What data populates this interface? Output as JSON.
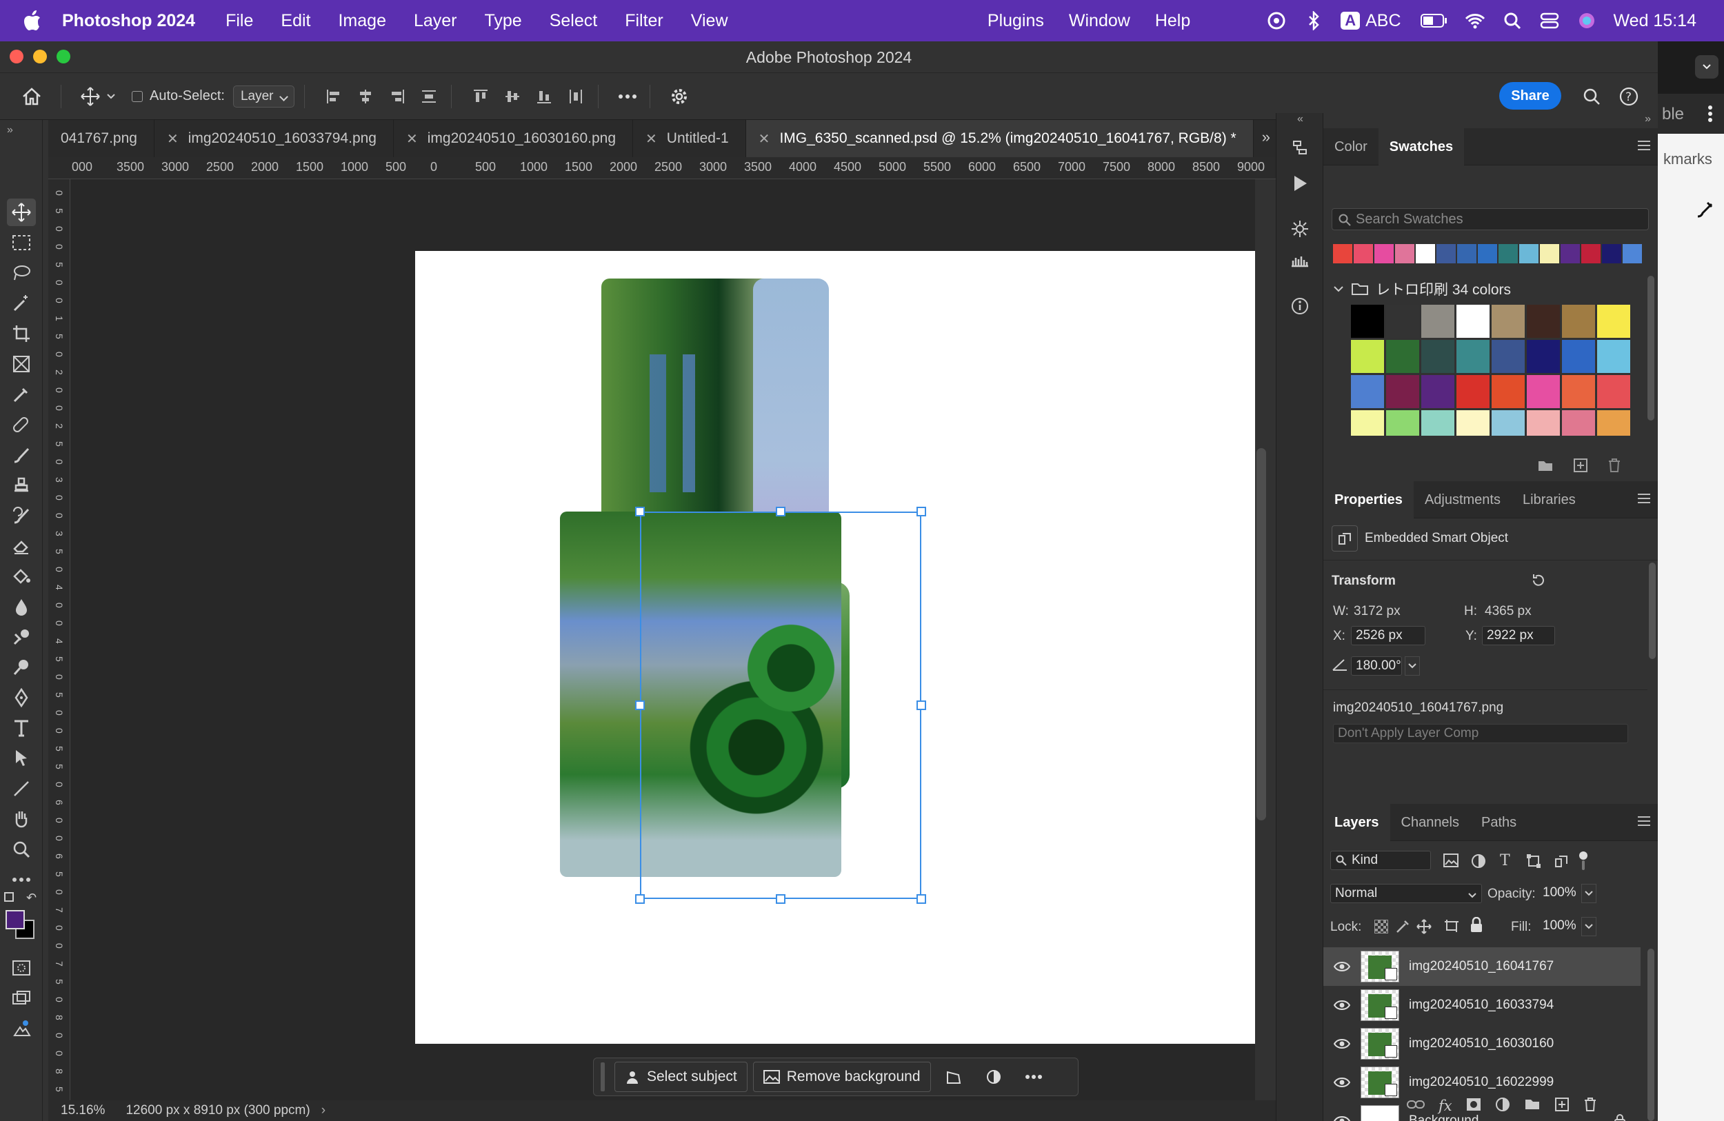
{
  "menubar": {
    "app_name": "Photoshop 2024",
    "menus": [
      "File",
      "Edit",
      "Image",
      "Layer",
      "Type",
      "Select",
      "Filter",
      "View"
    ],
    "right_menus": [
      "Plugins",
      "Window",
      "Help"
    ],
    "input_source": "ABC",
    "input_badge": "A",
    "clock": "Wed  15:14"
  },
  "window": {
    "title": "Adobe Photoshop 2024"
  },
  "options_bar": {
    "auto_select_label": "Auto-Select:",
    "auto_select_value": "Layer",
    "share_label": "Share"
  },
  "doc_tabs": [
    {
      "label": "041767.png",
      "closable": false
    },
    {
      "label": "img20240510_16033794.png",
      "closable": true
    },
    {
      "label": "img20240510_16030160.png",
      "closable": true
    },
    {
      "label": "Untitled-1",
      "closable": true
    },
    {
      "label": "IMG_6350_scanned.psd @ 15.2% (img20240510_16041767, RGB/8) *",
      "closable": true,
      "active": true
    }
  ],
  "ruler_h_labels": [
    "000",
    "3500",
    "3000",
    "2500",
    "2000",
    "1500",
    "1000",
    "500",
    "0",
    "500",
    "1000",
    "1500",
    "2000",
    "2500",
    "3000",
    "3500",
    "4000",
    "4500",
    "5000",
    "5500",
    "6000",
    "6500",
    "7000",
    "7500",
    "8000",
    "8500",
    "9000"
  ],
  "ruler_v_labels": [
    "0",
    "5",
    "0",
    "0",
    "5",
    "0",
    "0",
    "1",
    "5",
    "0",
    "2",
    "0",
    "0",
    "2",
    "5",
    "0",
    "3",
    "0",
    "0",
    "3",
    "5",
    "0",
    "4",
    "0",
    "0",
    "4",
    "5",
    "0",
    "5",
    "0",
    "0",
    "5",
    "5",
    "0",
    "6",
    "0",
    "0",
    "6",
    "5",
    "0",
    "7",
    "0",
    "0",
    "7",
    "5",
    "0",
    "8",
    "0",
    "0",
    "8",
    "5",
    "0"
  ],
  "contextual_taskbar": {
    "select_subject": "Select subject",
    "remove_background": "Remove background"
  },
  "status": {
    "zoom": "15.16%",
    "doc_info": "12600 px x 8910 px (300 ppcm)"
  },
  "swatches_panel": {
    "tabs": [
      "Color",
      "Swatches"
    ],
    "active_tab": "Swatches",
    "search_placeholder": "Search Swatches",
    "recent": [
      "#e8453c",
      "#e94e6a",
      "#e64ca0",
      "#e0749a",
      "#ffffff",
      "#3d5a9a",
      "#3567b0",
      "#2e6fc2",
      "#2c7a78",
      "#6bb8d8",
      "#f6f0b0",
      "#5a2b8a",
      "#c2213a",
      "#1d1a6e",
      "#4f86d8"
    ],
    "group_name": "レトロ印刷 34 colors",
    "grid": [
      "#000000",
      "#333333",
      "#8f8c85",
      "#ffffff",
      "#a8906b",
      "#3f2720",
      "#a07c43",
      "#f7e94a",
      "#c8ea4b",
      "#2e6d32",
      "#2e4d4b",
      "#3a8a8c",
      "#3b5590",
      "#1b1a72",
      "#2f67c4",
      "#6cc2e2",
      "#4f7fd0",
      "#7a1f4a",
      "#582680",
      "#d9312a",
      "#e24e2a",
      "#e64fa2",
      "#e8643f",
      "#e65056",
      "#f5f7a0",
      "#8ed870",
      "#8fd4c4",
      "#fdf6c4",
      "#8fc7dd",
      "#f2b0b0",
      "#e07890",
      "#e8a04a"
    ]
  },
  "properties_panel": {
    "tabs": [
      "Properties",
      "Adjustments",
      "Libraries"
    ],
    "active_tab": "Properties",
    "object_type": "Embedded Smart Object",
    "transform_label": "Transform",
    "w_label": "W:",
    "w_value": "3172 px",
    "h_label": "H:",
    "h_value": "4365 px",
    "x_label": "X:",
    "x_value": "2526 px",
    "y_label": "Y:",
    "y_value": "2922 px",
    "angle_value": "180.00°",
    "source_file": "img20240510_16041767.png",
    "layer_comp": "Don't Apply Layer Comp"
  },
  "layers_panel": {
    "tabs": [
      "Layers",
      "Channels",
      "Paths"
    ],
    "active_tab": "Layers",
    "filter_kind": "Kind",
    "blend_mode": "Normal",
    "opacity_label": "Opacity:",
    "opacity_value": "100%",
    "lock_label": "Lock:",
    "fill_label": "Fill:",
    "fill_value": "100%",
    "layers": [
      {
        "name": "img20240510_16041767",
        "selected": true,
        "locked": false
      },
      {
        "name": "img20240510_16033794",
        "selected": false,
        "locked": false
      },
      {
        "name": "img20240510_16030160",
        "selected": false,
        "locked": false
      },
      {
        "name": "img20240510_16022999",
        "selected": false,
        "locked": false
      },
      {
        "name": "Background",
        "selected": false,
        "locked": true
      }
    ]
  },
  "right_strip": {
    "partial_text_1": "ble",
    "partial_text_2": "kmarks"
  },
  "colors": {
    "menubar": "#5b2fb0",
    "accent": "#1473e6",
    "foreground_color": "#4b1f7a",
    "background_color": "#000000"
  }
}
